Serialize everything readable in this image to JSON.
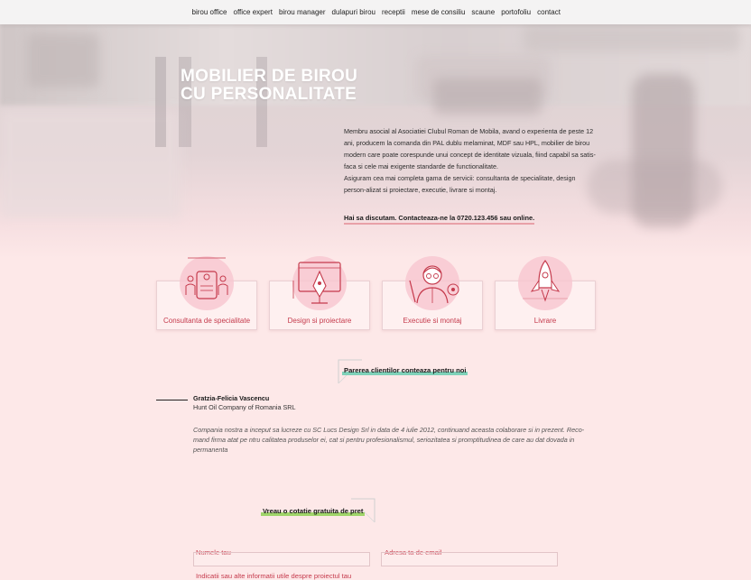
{
  "nav": {
    "items": [
      "birou office",
      "office expert",
      "birou manager",
      "dulapuri birou",
      "receptii",
      "mese de consiliu",
      "scaune",
      "portofoliu",
      "contact"
    ]
  },
  "hero": {
    "title_line1": "MOBILIER DE BIROU",
    "title_line2": "CU PERSONALITATE",
    "paragraph1": "Membru asocial al Asociatiei Clubul Roman de Mobila, avand o experienta de peste 12 ani, producem la comanda din PAL dublu melaminat, MDF sau HPL, mobilier de birou modern care poate corespunde unui concept de identitate vizuala, fiind capabil sa satis-faca si cele mai exigente standarde de functionalitate.",
    "paragraph2": "Asiguram cea mai completa gama de servicii: consultanta de specialitate, design person-alizat si proiectare, executie, livrare si montaj.",
    "cta": "Hai sa discutam. Contacteaza-ne la 0720.123.456 sau online."
  },
  "services": [
    {
      "label": "Consultanta de specialitate",
      "icon": "meeting-icon"
    },
    {
      "label": "Design si proiectare",
      "icon": "design-pen-icon"
    },
    {
      "label": "Executie si montaj",
      "icon": "worker-gear-icon"
    },
    {
      "label": "Livrare",
      "icon": "rocket-icon"
    }
  ],
  "testimonials": {
    "heading": "Parerea clientilor conteaza pentru noi",
    "name": "Gratzia-Felicia Vascencu",
    "company": "Hunt Oil Company of Romania SRL",
    "quote": "Compania nostra a inceput sa lucreze cu SC Lucs Design Srl in data de 4 iulie 2012, continuand aceasta colaborare si in prezent. Reco-mand firma atat pe ntru calitatea produselor ei, cat si pentru profesionalismul, seriozitatea si promptitudinea de care au dat dovada in permanenta"
  },
  "quote_form": {
    "heading": "Vreau o cotatie gratuita de pret",
    "name_label": "Numele tau",
    "email_label": "Adresa ta de email",
    "details_label": "Indicatii sau alte informatii utile despre proiectul tau"
  },
  "colors": {
    "accent_red": "#c53a4c",
    "underline_pink": "#e8a0a8",
    "underline_teal": "#7fd1b9",
    "underline_green": "#9fd46a",
    "page_bg": "#fde8e8"
  }
}
